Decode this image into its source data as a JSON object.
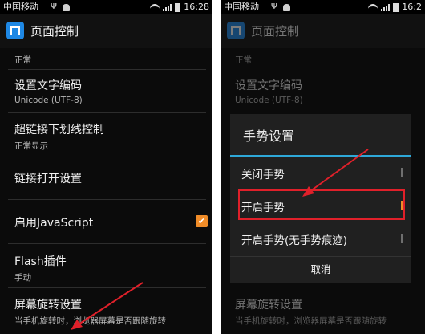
{
  "status_bar": {
    "carrier": "中国移动",
    "usb_icon": "usb-icon",
    "time": "16:28",
    "time_truncated": "16:2"
  },
  "app_bar": {
    "title": "页面控制",
    "icon": "browser-app-icon"
  },
  "settings": {
    "partial_summary": "正常",
    "text_encoding": {
      "title": "设置文字编码",
      "summary": "Unicode (UTF-8)"
    },
    "link_underline": {
      "title": "超链接下划线控制",
      "summary": "正常显示"
    },
    "link_open": {
      "title": "链接打开设置"
    },
    "javascript": {
      "title": "启用JavaScript",
      "checked": true
    },
    "flash": {
      "title": "Flash插件",
      "summary": "手动"
    },
    "screen_rotation": {
      "title": "屏幕旋转设置",
      "summary": "当手机旋转时，浏览器屏幕是否跟随旋转"
    }
  },
  "gesture_dialog": {
    "title": "手势设置",
    "options": [
      "关闭手势",
      "开启手势",
      "开启手势(无手势痕迹)"
    ],
    "selected_index": 1,
    "cancel": "取消"
  },
  "colors": {
    "accent": "#f08c28",
    "dialog_divider": "#2ea8d8",
    "annotation": "#e0202a"
  }
}
